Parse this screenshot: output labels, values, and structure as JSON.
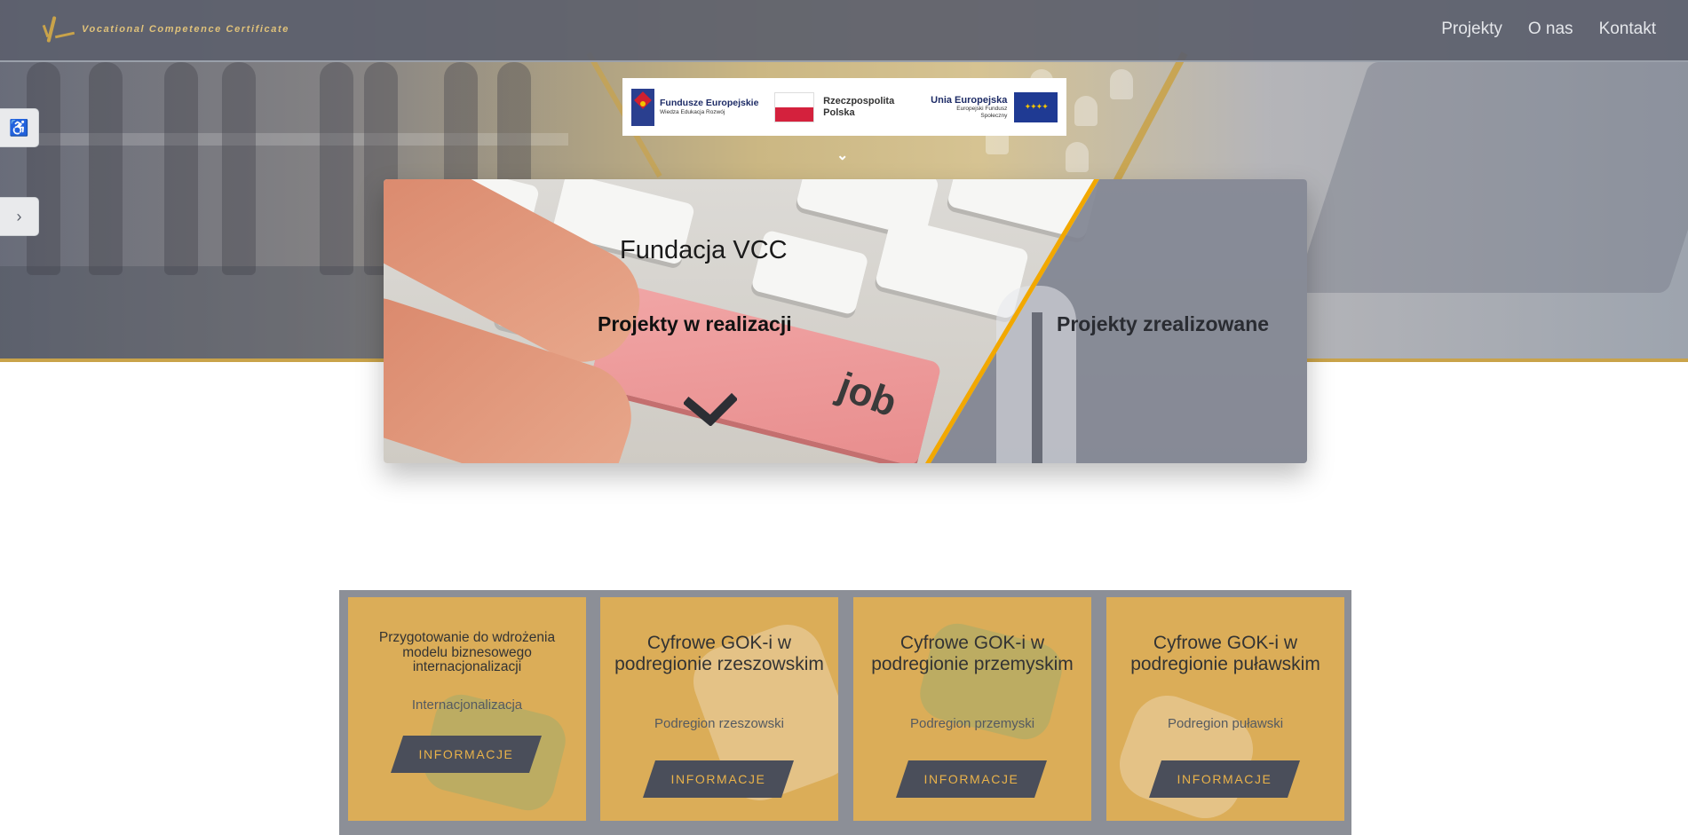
{
  "brand": {
    "name": "Vocational Competence Certificate",
    "gold": "#c9a34a"
  },
  "nav": {
    "items": [
      "Projekty",
      "O nas",
      "Kontakt"
    ]
  },
  "side_tabs": {
    "accessibility_icon": "wheelchair-icon",
    "next_icon": "chevron-right-icon"
  },
  "eu_strip": {
    "fe_title": "Fundusze Europejskie",
    "fe_sub": "Wiedza Edukacja Rozwój",
    "rp_title": "Rzeczpospolita Polska",
    "ue_title": "Unia Europejska",
    "ue_sub": "Europejski Fundusz Społeczny"
  },
  "hero_card": {
    "title": "Fundacja VCC",
    "left_label": "Projekty w realizacji",
    "right_label": "Projekty zrealizowane",
    "job_key": "job",
    "stripe_color": "#f2a800"
  },
  "project_cards": [
    {
      "title": "Przygotowanie do wdrożenia modelu biznesowego internacjonalizacji",
      "subtitle": "Internacjonalizacja",
      "button": "INFORMACJE"
    },
    {
      "title": "Cyfrowe GOK-i w podregionie rzeszowskim",
      "subtitle": "Podregion rzeszowski",
      "button": "INFORMACJE"
    },
    {
      "title": "Cyfrowe GOK-i w podregionie przemyskim",
      "subtitle": "Podregion przemyski",
      "button": "INFORMACJE"
    },
    {
      "title": "Cyfrowe GOK-i w podregionie puławskim",
      "subtitle": "Podregion puławski",
      "button": "INFORMACJE"
    }
  ]
}
